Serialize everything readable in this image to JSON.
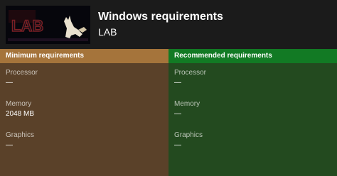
{
  "header": {
    "title": "Windows requirements",
    "game_name": "LAB",
    "thumbnail_text": "LAB"
  },
  "columns": [
    {
      "heading": "Minimum requirements",
      "rows": [
        {
          "label": "Processor",
          "value": "—"
        },
        {
          "label": "Memory",
          "value": "2048 MB"
        },
        {
          "label": "Graphics",
          "value": "—"
        }
      ]
    },
    {
      "heading": "Recommended requirements",
      "rows": [
        {
          "label": "Processor",
          "value": "—"
        },
        {
          "label": "Memory",
          "value": "—"
        },
        {
          "label": "Graphics",
          "value": "—"
        }
      ]
    }
  ],
  "colors": {
    "background": "#1b1b1b",
    "minimum_header": "#a5743b",
    "minimum_body": "#5a4129",
    "recommended_header": "#127a24",
    "recommended_body": "#234a1f"
  }
}
